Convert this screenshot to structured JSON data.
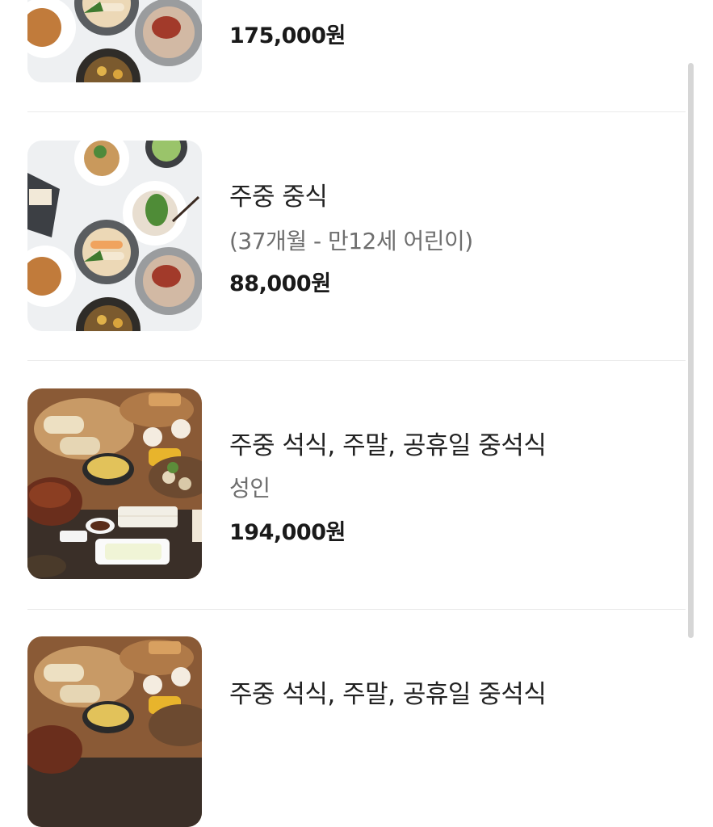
{
  "menu_items": [
    {
      "name": "",
      "subtitle": "",
      "price": "175,000원",
      "image": "korean-chinese-buffet-dishes"
    },
    {
      "name": "주중 중식",
      "subtitle": "(37개월 - 만12세 어린이)",
      "price": "88,000원",
      "image": "korean-chinese-buffet-dishes"
    },
    {
      "name": "주중 석식, 주말, 공휴일 중석식",
      "subtitle": "성인",
      "price": "194,000원",
      "image": "peking-duck-buffet-table"
    },
    {
      "name": "주중 석식, 주말, 공휴일 중석식",
      "subtitle": "",
      "price": "",
      "image": "peking-duck-buffet-table"
    }
  ],
  "colors": {
    "divider": "#e9e9e9",
    "price": "#1a1a1a",
    "subtitle": "#6e6e6e",
    "scrollbar": "#d6d6d6"
  }
}
